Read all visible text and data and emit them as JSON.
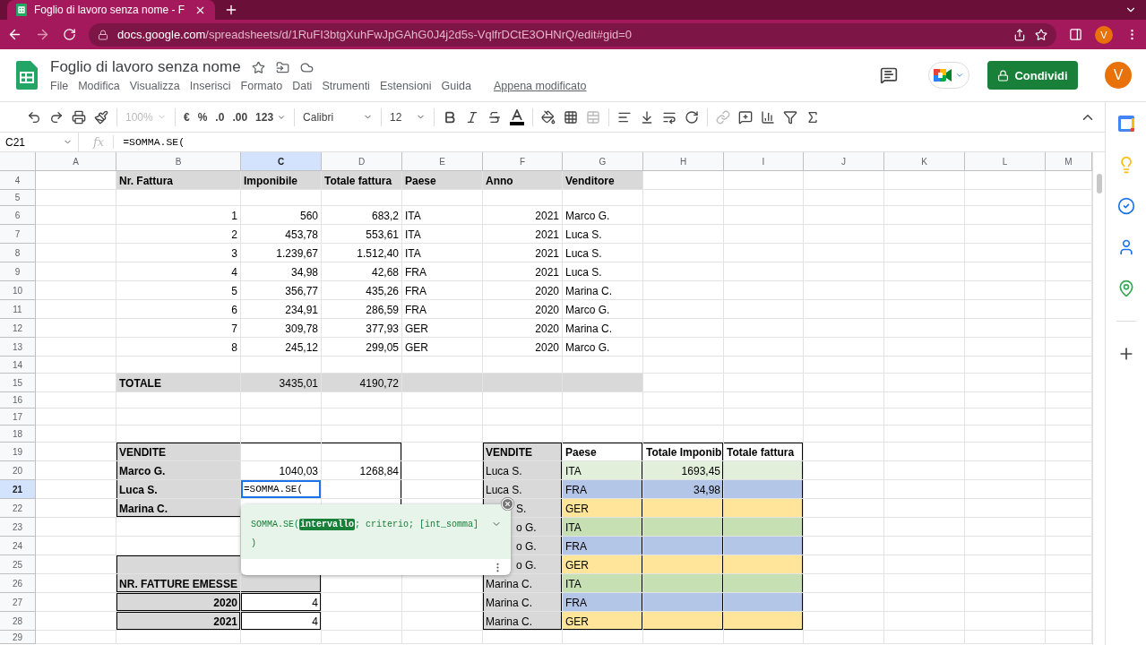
{
  "browser": {
    "tab_title": "Foglio di lavoro senza nome - F",
    "url_host": "docs.google.com",
    "url_path": "/spreadsheets/d/1RuFI3btgXuhFwJpGAhG0J4j2d5s-VqlfrDCtE3OHNrQ/edit#gid=0",
    "profile_initial": "V"
  },
  "doc": {
    "title": "Foglio di lavoro senza nome",
    "menu": [
      "File",
      "Modifica",
      "Visualizza",
      "Inserisci",
      "Formato",
      "Dati",
      "Strumenti",
      "Estensioni",
      "Guida"
    ],
    "last_edit": "Appena modificato",
    "share_label": "Condividi",
    "avatar_initial": "V"
  },
  "toolbar": {
    "zoom": "100%",
    "currency": "€",
    "percent": "%",
    "decrease_decimals": ".0",
    "increase_decimals": ".00",
    "number_format": "123",
    "font": "Calibri",
    "font_size": "12"
  },
  "formula_bar": {
    "cell_ref": "C21",
    "fx": "fx",
    "formula": "=SOMMA.SE("
  },
  "columns": [
    {
      "label": "A",
      "selected": false
    },
    {
      "label": "B",
      "selected": false
    },
    {
      "label": "C",
      "selected": true
    },
    {
      "label": "D",
      "selected": false
    },
    {
      "label": "E",
      "selected": false
    },
    {
      "label": "F",
      "selected": false
    },
    {
      "label": "G",
      "selected": false
    },
    {
      "label": "H",
      "selected": false
    },
    {
      "label": "I",
      "selected": false
    },
    {
      "label": "J",
      "selected": false
    },
    {
      "label": "K",
      "selected": false
    },
    {
      "label": "L",
      "selected": false
    },
    {
      "label": "M",
      "selected": false
    }
  ],
  "rows": [
    {
      "number": "4",
      "selected": false,
      "cells": {
        "B": {
          "text": "Nr. Fattura",
          "bold": true,
          "kind": "text",
          "color": "#d9d9d9"
        },
        "C": {
          "text": "Imponibile",
          "bold": true,
          "kind": "text",
          "color": "#d9d9d9"
        },
        "D": {
          "text": "Totale fattura",
          "bold": true,
          "kind": "text",
          "color": "#d9d9d9"
        },
        "E": {
          "text": "Paese",
          "bold": true,
          "kind": "text",
          "color": "#d9d9d9"
        },
        "F": {
          "text": "Anno",
          "bold": true,
          "kind": "text",
          "color": "#d9d9d9"
        },
        "G": {
          "text": "Venditore",
          "bold": true,
          "kind": "text",
          "color": "#d9d9d9"
        }
      }
    },
    {
      "number": "5",
      "selected": false,
      "cells": {}
    },
    {
      "number": "6",
      "selected": false,
      "cells": {
        "B": {
          "text": "1",
          "kind": "number"
        },
        "C": {
          "text": "560",
          "kind": "number"
        },
        "D": {
          "text": "683,2",
          "kind": "number"
        },
        "E": {
          "text": "ITA",
          "kind": "text"
        },
        "F": {
          "text": "2021",
          "kind": "number"
        },
        "G": {
          "text": "Marco G.",
          "kind": "text"
        }
      }
    },
    {
      "number": "7",
      "selected": false,
      "cells": {
        "B": {
          "text": "2",
          "kind": "number"
        },
        "C": {
          "text": "453,78",
          "kind": "number"
        },
        "D": {
          "text": "553,61",
          "kind": "number"
        },
        "E": {
          "text": "ITA",
          "kind": "text"
        },
        "F": {
          "text": "2021",
          "kind": "number"
        },
        "G": {
          "text": "Luca S.",
          "kind": "text"
        }
      }
    },
    {
      "number": "8",
      "selected": false,
      "cells": {
        "B": {
          "text": "3",
          "kind": "number"
        },
        "C": {
          "text": "1.239,67",
          "kind": "number"
        },
        "D": {
          "text": "1.512,40",
          "kind": "number"
        },
        "E": {
          "text": "ITA",
          "kind": "text"
        },
        "F": {
          "text": "2021",
          "kind": "number"
        },
        "G": {
          "text": "Luca S.",
          "kind": "text"
        }
      }
    },
    {
      "number": "9",
      "selected": false,
      "cells": {
        "B": {
          "text": "4",
          "kind": "number"
        },
        "C": {
          "text": "34,98",
          "kind": "number"
        },
        "D": {
          "text": "42,68",
          "kind": "number"
        },
        "E": {
          "text": "FRA",
          "kind": "text"
        },
        "F": {
          "text": "2021",
          "kind": "number"
        },
        "G": {
          "text": "Luca S.",
          "kind": "text"
        }
      }
    },
    {
      "number": "10",
      "selected": false,
      "cells": {
        "B": {
          "text": "5",
          "kind": "number"
        },
        "C": {
          "text": "356,77",
          "kind": "number"
        },
        "D": {
          "text": "435,26",
          "kind": "number"
        },
        "E": {
          "text": "FRA",
          "kind": "text"
        },
        "F": {
          "text": "2020",
          "kind": "number"
        },
        "G": {
          "text": "Marina C.",
          "kind": "text"
        }
      }
    },
    {
      "number": "11",
      "selected": false,
      "cells": {
        "B": {
          "text": "6",
          "kind": "number"
        },
        "C": {
          "text": "234,91",
          "kind": "number"
        },
        "D": {
          "text": "286,59",
          "kind": "number"
        },
        "E": {
          "text": "FRA",
          "kind": "text"
        },
        "F": {
          "text": "2020",
          "kind": "number"
        },
        "G": {
          "text": "Marco G.",
          "kind": "text"
        }
      }
    },
    {
      "number": "12",
      "selected": false,
      "cells": {
        "B": {
          "text": "7",
          "kind": "number"
        },
        "C": {
          "text": "309,78",
          "kind": "number"
        },
        "D": {
          "text": "377,93",
          "kind": "number"
        },
        "E": {
          "text": "GER",
          "kind": "text"
        },
        "F": {
          "text": "2020",
          "kind": "number"
        },
        "G": {
          "text": "Marina C.",
          "kind": "text"
        }
      }
    },
    {
      "number": "13",
      "selected": false,
      "cells": {
        "B": {
          "text": "8",
          "kind": "number"
        },
        "C": {
          "text": "245,12",
          "kind": "number"
        },
        "D": {
          "text": "299,05",
          "kind": "number"
        },
        "E": {
          "text": "GER",
          "kind": "text"
        },
        "F": {
          "text": "2020",
          "kind": "number"
        },
        "G": {
          "text": "Marco G.",
          "kind": "text"
        }
      }
    },
    {
      "number": "14",
      "selected": false,
      "cells": {}
    },
    {
      "number": "15",
      "selected": false,
      "cells": {
        "B": {
          "text": "TOTALE",
          "bold": true,
          "kind": "text",
          "color": "#d9d9d9"
        },
        "C": {
          "text": "3435,01",
          "kind": "number",
          "color": "#d9d9d9"
        },
        "D": {
          "text": "4190,72",
          "kind": "number",
          "color": "#d9d9d9"
        },
        "E": {
          "color": "#d9d9d9"
        },
        "F": {
          "color": "#d9d9d9"
        },
        "G": {
          "color": "#d9d9d9"
        }
      }
    },
    {
      "number": "16",
      "selected": false,
      "cells": {}
    },
    {
      "number": "17",
      "selected": false,
      "cells": {}
    },
    {
      "number": "18",
      "selected": false,
      "cells": {}
    },
    {
      "number": "19",
      "selected": false,
      "cells": {
        "B": {
          "text": "VENDITE",
          "bold": true,
          "kind": "text",
          "color": "#d9d9d9",
          "border_top": true,
          "border_left": true
        },
        "C": {
          "border_top": true
        },
        "D": {
          "border_top": true,
          "border_right": true
        },
        "F": {
          "text": "VENDITE",
          "bold": true,
          "kind": "text",
          "color": "#d9d9d9",
          "border_top": true,
          "border_left": true,
          "border_right": true
        },
        "G": {
          "text": "Paese",
          "bold": true,
          "kind": "text",
          "border_top": true,
          "border_right": true
        },
        "H": {
          "text": "Totale Imponib",
          "bold": true,
          "kind": "text",
          "border_top": true,
          "border_right": true
        },
        "I": {
          "text": "Totale fattura",
          "bold": true,
          "kind": "text",
          "border_top": true,
          "border_right": true
        }
      }
    },
    {
      "number": "20",
      "selected": false,
      "cells": {
        "B": {
          "text": "Marco G.",
          "bold": true,
          "kind": "text",
          "color": "#d9d9d9",
          "border_left": true
        },
        "C": {
          "text": "1040,03",
          "kind": "number"
        },
        "D": {
          "text": "1268,84",
          "kind": "number",
          "border_right": true
        },
        "F": {
          "text": "Luca S.",
          "kind": "text",
          "color": "#d9d9d9",
          "border_left": true,
          "border_right": true
        },
        "G": {
          "text": "ITA",
          "kind": "text",
          "color": "#e2efda",
          "border_right": true
        },
        "H": {
          "text": "1693,45",
          "kind": "number",
          "color": "#e2efda",
          "border_right": true
        },
        "I": {
          "color": "#e2efda",
          "border_right": true
        }
      }
    },
    {
      "number": "21",
      "selected": true,
      "cells": {
        "B": {
          "text": "Luca S.",
          "bold": true,
          "kind": "text",
          "color": "#d9d9d9",
          "border_left": true
        },
        "C": {
          "text": "=SOMMA.SE(",
          "kind": "editing"
        },
        "D": {
          "border_right": true
        },
        "F": {
          "text": "Luca S.",
          "kind": "text",
          "color": "#d9d9d9",
          "border_left": true,
          "border_right": true
        },
        "G": {
          "text": "FRA",
          "kind": "text",
          "color": "#b4c6e7",
          "border_right": true
        },
        "H": {
          "text": "34,98",
          "kind": "number",
          "color": "#b4c6e7",
          "border_right": true
        },
        "I": {
          "color": "#b4c6e7",
          "border_right": true
        }
      }
    },
    {
      "number": "22",
      "selected": false,
      "cells": {
        "B": {
          "text": "Marina C.",
          "bold": true,
          "kind": "text",
          "color": "#d9d9d9",
          "border_left": true,
          "border_bottom": true
        },
        "C": {
          "border_bottom": true
        },
        "D": {
          "border_bottom": true,
          "border_right": true
        },
        "F": {
          "text": "S.",
          "kind": "covered",
          "color": "#d9d9d9",
          "border_left": true,
          "border_right": true
        },
        "G": {
          "text": "GER",
          "kind": "text",
          "color": "#ffe599",
          "border_right": true
        },
        "H": {
          "color": "#ffe599",
          "border_right": true
        },
        "I": {
          "color": "#ffe599",
          "border_right": true
        }
      }
    },
    {
      "number": "23",
      "selected": false,
      "cells": {
        "F": {
          "text": "o G.",
          "kind": "covered",
          "color": "#d9d9d9",
          "border_left": true,
          "border_right": true
        },
        "G": {
          "text": "ITA",
          "kind": "text",
          "color": "#c6e0b4",
          "border_right": true
        },
        "H": {
          "color": "#c6e0b4",
          "border_right": true
        },
        "I": {
          "color": "#c6e0b4",
          "border_right": true
        }
      }
    },
    {
      "number": "24",
      "selected": false,
      "cells": {
        "F": {
          "text": "o G.",
          "kind": "covered",
          "color": "#d9d9d9",
          "border_left": true,
          "border_right": true
        },
        "G": {
          "text": "FRA",
          "kind": "text",
          "color": "#b4c6e7",
          "border_right": true
        },
        "H": {
          "color": "#b4c6e7",
          "border_right": true
        },
        "I": {
          "color": "#b4c6e7",
          "border_right": true
        }
      }
    },
    {
      "number": "25",
      "selected": false,
      "cells": {
        "B": {
          "color": "#d9d9d9",
          "border_top": true,
          "border_left": true
        },
        "F": {
          "text": "o G.",
          "kind": "covered",
          "color": "#d9d9d9",
          "border_left": true,
          "border_right": true
        },
        "G": {
          "text": "GER",
          "kind": "text",
          "color": "#ffe599",
          "border_right": true
        },
        "H": {
          "color": "#ffe599",
          "border_right": true
        },
        "I": {
          "color": "#ffe599",
          "border_right": true
        }
      }
    },
    {
      "number": "26",
      "selected": false,
      "cells": {
        "B": {
          "text": "NR. FATTURE EMESSE",
          "bold": true,
          "kind": "center",
          "color": "#d9d9d9",
          "border_left": true,
          "border_bottom": true
        },
        "C": {
          "color": "#d9d9d9",
          "border_right": true,
          "border_bottom": true
        },
        "F": {
          "text": "Marina C.",
          "kind": "text",
          "color": "#d9d9d9",
          "border_left": true,
          "border_right": true
        },
        "G": {
          "text": "ITA",
          "kind": "text",
          "color": "#c6e0b4",
          "border_right": true
        },
        "H": {
          "color": "#c6e0b4",
          "border_right": true
        },
        "I": {
          "color": "#c6e0b4",
          "border_right": true
        }
      }
    },
    {
      "number": "27",
      "selected": false,
      "cells": {
        "B": {
          "text": "2020",
          "bold": true,
          "kind": "number",
          "color": "#d9d9d9",
          "border_top": true,
          "border_right": true,
          "border_bottom": true,
          "border_left": true
        },
        "C": {
          "text": "4",
          "kind": "number",
          "border_top": true,
          "border_right": true,
          "border_bottom": true,
          "border_left": true
        },
        "F": {
          "text": "Marina C.",
          "kind": "text",
          "color": "#d9d9d9",
          "border_left": true,
          "border_right": true
        },
        "G": {
          "text": "FRA",
          "kind": "text",
          "color": "#b4c6e7",
          "border_right": true
        },
        "H": {
          "color": "#b4c6e7",
          "border_right": true
        },
        "I": {
          "color": "#b4c6e7",
          "border_right": true
        }
      }
    },
    {
      "number": "28",
      "selected": false,
      "cells": {
        "B": {
          "text": "2021",
          "bold": true,
          "kind": "number",
          "color": "#d9d9d9",
          "border_top": true,
          "border_right": true,
          "border_bottom": true,
          "border_left": true
        },
        "C": {
          "text": "4",
          "kind": "number",
          "border_top": true,
          "border_right": true,
          "border_bottom": true,
          "border_left": true
        },
        "F": {
          "text": "Marina C.",
          "kind": "text",
          "color": "#d9d9d9",
          "border_left": true,
          "border_right": true,
          "border_bottom": true
        },
        "G": {
          "text": "GER",
          "kind": "text",
          "color": "#ffe599",
          "border_right": true,
          "border_bottom": true
        },
        "H": {
          "color": "#ffe599",
          "border_right": true,
          "border_bottom": true
        },
        "I": {
          "color": "#ffe599",
          "border_right": true,
          "border_bottom": true
        }
      }
    },
    {
      "number": "29",
      "selected": false,
      "cells": {}
    }
  ],
  "formula_hint": {
    "function": "SOMMA.SE(",
    "active_argument": "intervallo",
    "rest": "; criterio; [int_somma]",
    "closing": ")"
  }
}
